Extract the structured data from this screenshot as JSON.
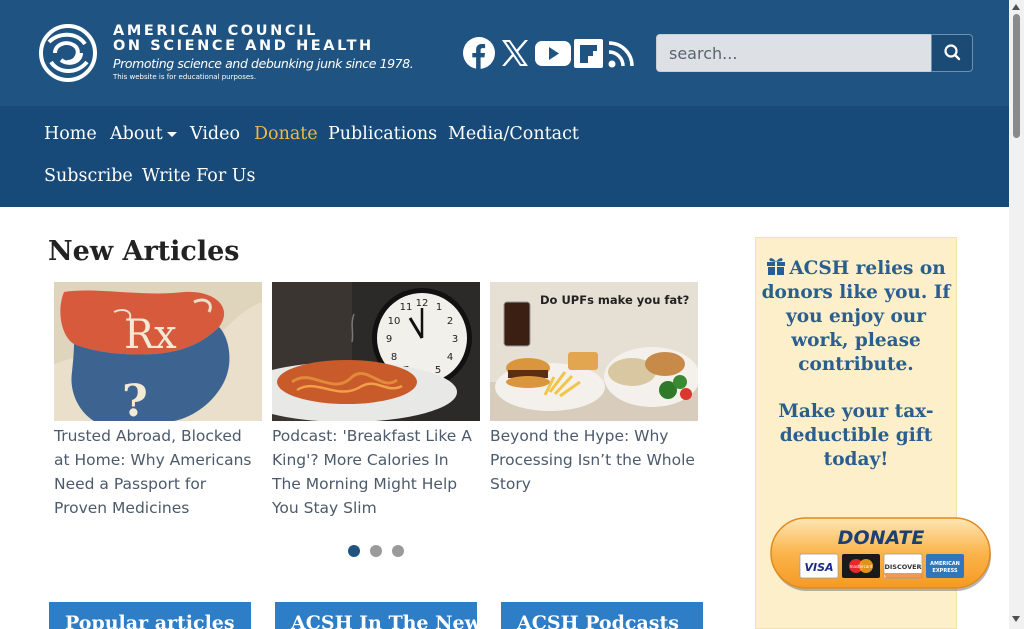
{
  "header": {
    "logo_line1": "AMERICAN COUNCIL",
    "logo_line2": "ON SCIENCE AND HEALTH",
    "tagline": "Promoting science and debunking junk since 1978.",
    "subline": "This website is for educational purposes.",
    "social": [
      "facebook-icon",
      "x-icon",
      "youtube-icon",
      "flipboard-icon",
      "rss-icon"
    ],
    "search_placeholder": "search..."
  },
  "nav": {
    "items": [
      {
        "label": "Home"
      },
      {
        "label": "About"
      },
      {
        "label": "Video"
      },
      {
        "label": "Donate"
      },
      {
        "label": "Publications"
      },
      {
        "label": "Media/Contact"
      },
      {
        "label": "Subscribe"
      },
      {
        "label": "Write For Us"
      }
    ]
  },
  "main": {
    "section_title": "New Articles",
    "articles": [
      {
        "title": "Trusted Abroad, Blocked at Home: Why Americans Need a Passport for Proven Medicines",
        "image_text_rx": "Rx",
        "image_text_q": "?"
      },
      {
        "title": "Podcast: 'Breakfast Like A King'? More Calories In The Morning Might Help You Stay Slim"
      },
      {
        "title": "Beyond the Hype: Why Processing Isn’t the Whole Story",
        "image_text": "Do UPFs make you fat?"
      }
    ],
    "carousel_active_index": 0,
    "carousel_count": 3,
    "tabs": [
      {
        "label": "Popular articles"
      },
      {
        "label": "ACSH In The News"
      },
      {
        "label": "ACSH Podcasts"
      }
    ]
  },
  "sidebar": {
    "donate_text": "ACSH relies on donors like you. If you enjoy our work, please contribute.",
    "donate_text2": "Make your tax-deductible gift today!",
    "donate_button": "DONATE",
    "cards": [
      "VISA",
      "mastercard",
      "DISCOVER",
      "AMERICAN EXPRESS"
    ]
  },
  "colors": {
    "header_bg": "#1f5381",
    "nav_bg": "#174a78",
    "donate_accent": "#f0b84b",
    "panel_bg": "#fcefc9",
    "tab_bg": "#2e7dc7"
  }
}
